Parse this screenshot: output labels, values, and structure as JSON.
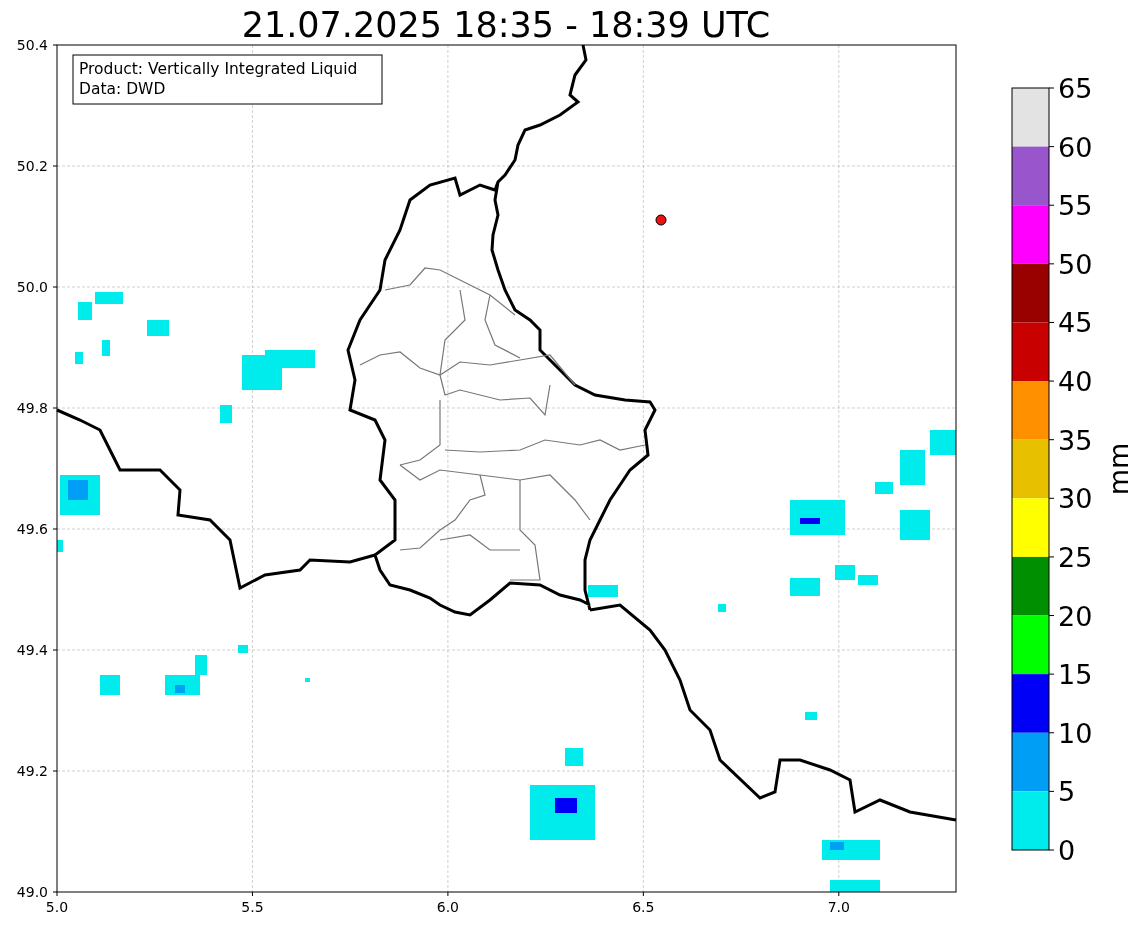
{
  "title": "21.07.2025 18:35 - 18:39 UTC",
  "legend": [
    "Product: Vertically Integrated Liquid",
    "Data: DWD"
  ],
  "map": {
    "xticks": [
      "5.0",
      "5.5",
      "6.0",
      "6.5",
      "7.0"
    ],
    "yticks": [
      "50.4",
      "50.2",
      "50.0",
      "49.8",
      "49.6",
      "49.4",
      "49.2",
      "49.0"
    ]
  },
  "colorbar": {
    "label": "mm",
    "ticks": [
      "65",
      "60",
      "55",
      "50",
      "45",
      "40",
      "35",
      "30",
      "25",
      "20",
      "15",
      "10",
      "5",
      "0"
    ],
    "bands": [
      {
        "color": "#e3e3e3"
      },
      {
        "color": "#9955cc"
      },
      {
        "color": "#ff00ff"
      },
      {
        "color": "#990000"
      },
      {
        "color": "#c80000"
      },
      {
        "color": "#ff9000"
      },
      {
        "color": "#e7c000"
      },
      {
        "color": "#ffff00"
      },
      {
        "color": "#008f00"
      },
      {
        "color": "#00ff00"
      },
      {
        "color": "#0000f6"
      },
      {
        "color": "#009ef5"
      },
      {
        "color": "#00ecec"
      }
    ]
  }
}
